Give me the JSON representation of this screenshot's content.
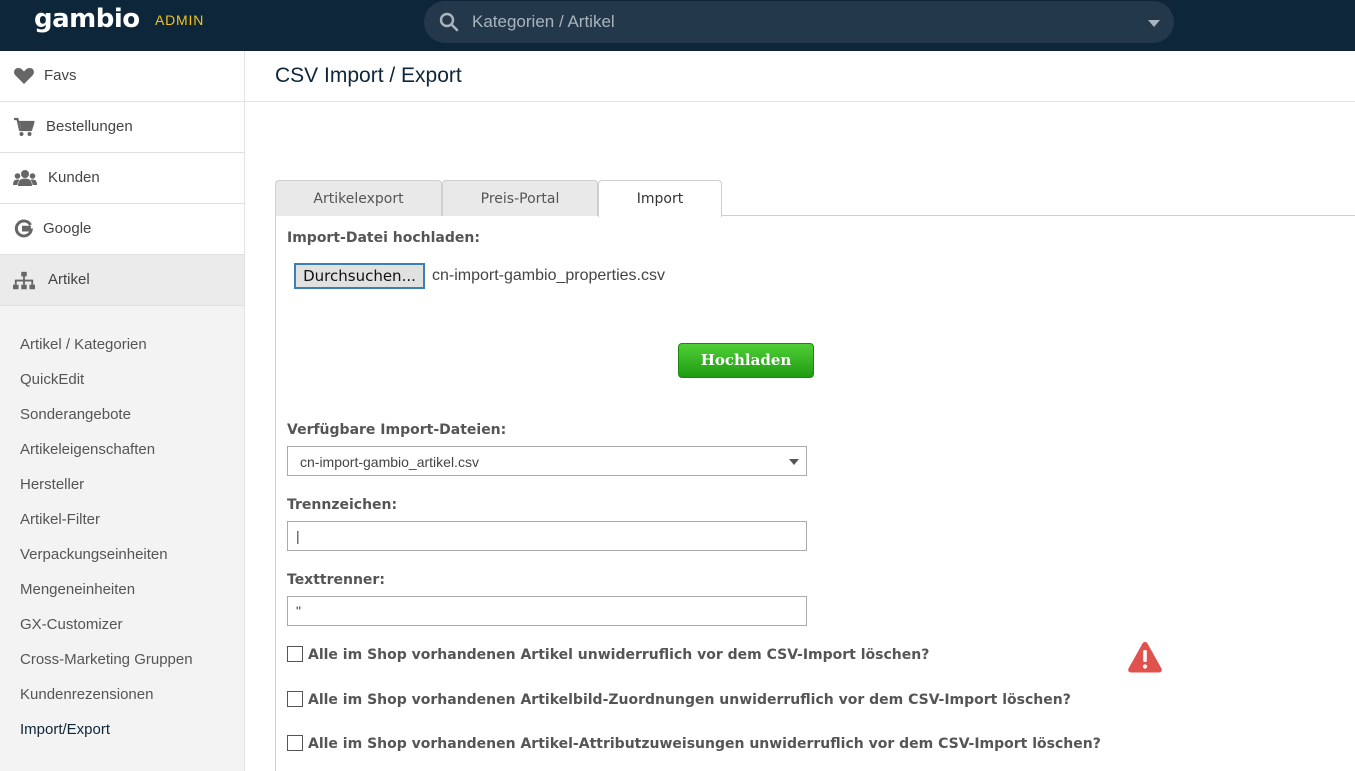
{
  "header": {
    "logo": "gambio",
    "badge": "ADMIN",
    "search_placeholder": "Kategorien / Artikel",
    "icons": {
      "search": "search-icon",
      "dropdown": "chevron-down-icon"
    }
  },
  "sidebar": {
    "items": [
      {
        "label": "Favs",
        "icon": "heart-icon"
      },
      {
        "label": "Bestellungen",
        "icon": "cart-icon"
      },
      {
        "label": "Kunden",
        "icon": "users-icon"
      },
      {
        "label": "Google",
        "icon": "google-icon"
      },
      {
        "label": "Artikel",
        "icon": "sitemap-icon"
      }
    ],
    "active_item": "Artikel",
    "subitems": [
      "Artikel / Kategorien",
      "QuickEdit",
      "Sonderangebote",
      "Artikeleigenschaften",
      "Hersteller",
      "Artikel-Filter",
      "Verpackungseinheiten",
      "Mengeneinheiten",
      "GX-Customizer",
      "Cross-Marketing Gruppen",
      "Kundenrezensionen",
      "Import/Export"
    ],
    "current_subitem": "Import/Export"
  },
  "main": {
    "title": "CSV Import / Export",
    "tabs": [
      {
        "label": "Artikelexport",
        "active": false
      },
      {
        "label": "Preis-Portal",
        "active": false
      },
      {
        "label": "Import",
        "active": true
      }
    ],
    "upload": {
      "label": "Import-Datei hochladen:",
      "browse_label": "Durchsuchen...",
      "selected_file": "cn-import-gambio_properties.csv",
      "upload_button": "Hochladen"
    },
    "available_files": {
      "label": "Verfügbare Import-Dateien:",
      "selected": "cn-import-gambio_artikel.csv"
    },
    "separator": {
      "label": "Trennzeichen:",
      "value": "|"
    },
    "text_delimiter": {
      "label": "Texttrenner:",
      "value": "\""
    },
    "checkboxes": [
      {
        "label": "Alle im Shop vorhandenen Artikel unwiderruflich vor dem CSV-Import löschen?",
        "checked": false
      },
      {
        "label": "Alle im Shop vorhandenen Artikelbild-Zuordnungen unwiderruflich vor dem CSV-Import löschen?",
        "checked": false
      },
      {
        "label": "Alle im Shop vorhandenen Artikel-Attributzuweisungen unwiderruflich vor dem CSV-Import löschen?",
        "checked": false
      }
    ],
    "warning_icon": "warning-triangle-icon",
    "colors": {
      "topbar": "#0e2639",
      "accent_badge": "#f0c419",
      "upload_button": "#2fb020",
      "warning": "#e0524d"
    }
  }
}
